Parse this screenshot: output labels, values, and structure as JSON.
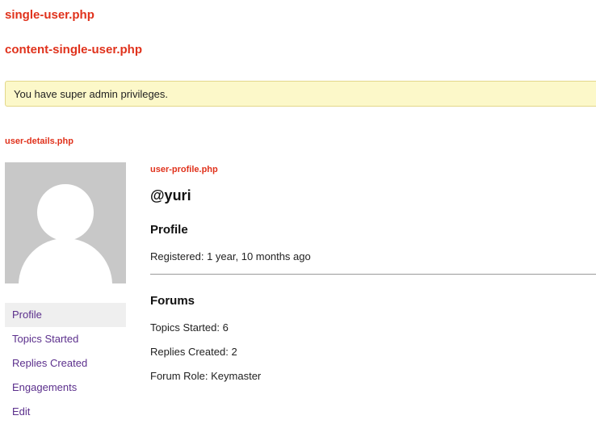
{
  "templates": {
    "single_user": "single-user.php",
    "content_single_user": "content-single-user.php",
    "user_details": "user-details.php",
    "user_profile": "user-profile.php"
  },
  "notice": {
    "text": "You have super admin privileges."
  },
  "avatar": {
    "icon": "default-avatar-icon"
  },
  "nav": {
    "items": [
      {
        "label": "Profile",
        "current": true
      },
      {
        "label": "Topics Started",
        "current": false
      },
      {
        "label": "Replies Created",
        "current": false
      },
      {
        "label": "Engagements",
        "current": false
      },
      {
        "label": "Edit",
        "current": false
      }
    ]
  },
  "profile": {
    "handle": "@yuri",
    "profile_heading": "Profile",
    "registered": "Registered: 1 year, 10 months ago",
    "forums_heading": "Forums",
    "topics_started": "Topics Started: 6",
    "replies_created": "Replies Created: 2",
    "forum_role": "Forum Role: Keymaster"
  },
  "colors": {
    "template_label": "#e0321c",
    "nav_link": "#5b2f8c",
    "notice_bg": "#fcf8c9",
    "avatar_bg": "#c8c8c8"
  }
}
